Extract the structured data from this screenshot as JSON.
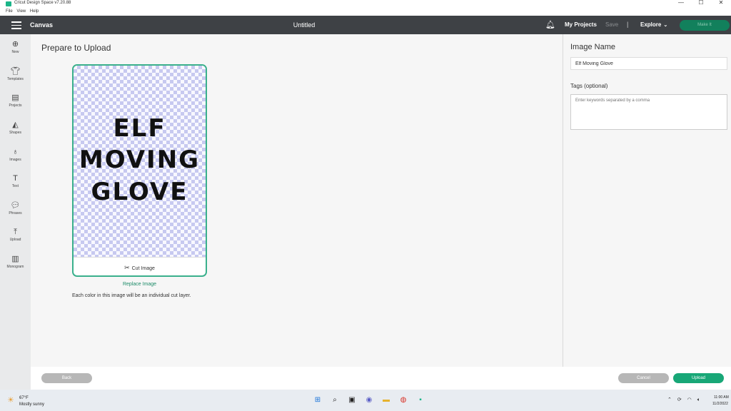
{
  "titlebar": {
    "title": "Cricut Design Space  v7.20.88",
    "minimize": "—",
    "maximize": "☐",
    "close": "✕"
  },
  "menu": {
    "items": [
      "File",
      "View",
      "Help"
    ]
  },
  "header": {
    "canvas_label": "Canvas",
    "doc_title": "Untitled",
    "my_projects": "My Projects",
    "save": "Save",
    "separator": "|",
    "explore": "Explore",
    "make_it": "Make It"
  },
  "leftnav": {
    "items": [
      {
        "label": "New",
        "icon": "plus-circle-icon"
      },
      {
        "label": "Templates",
        "icon": "shirt-icon"
      },
      {
        "label": "Projects",
        "icon": "clipboard-icon"
      },
      {
        "label": "Shapes",
        "icon": "shapes-icon"
      },
      {
        "label": "Images",
        "icon": "lightbulb-icon"
      },
      {
        "label": "Text",
        "icon": "text-icon"
      },
      {
        "label": "Phrases",
        "icon": "speech-bubble-icon"
      },
      {
        "label": "Upload",
        "icon": "upload-icon"
      },
      {
        "label": "Monogram",
        "icon": "monogram-icon"
      }
    ]
  },
  "main": {
    "title": "Prepare to Upload",
    "artwork_lines": [
      "ELF",
      "MOVING",
      "GLOVE"
    ],
    "cut_image_label": "Cut Image",
    "replace_image": "Replace Image",
    "hint": "Each color in this image will be an individual cut layer."
  },
  "rightpanel": {
    "image_name_label": "Image Name",
    "image_name_value": "Elf Moving Glove",
    "tags_label": "Tags (optional)",
    "tags_placeholder": "Enter keywords separated by a comma"
  },
  "footer": {
    "back": "Back",
    "cancel": "Cancel",
    "upload": "Upload"
  },
  "taskbar": {
    "temp": "67°F",
    "weather": "Mostly sunny",
    "time": "11:00 AM",
    "date": "11/2/2022"
  },
  "colors": {
    "accent": "#1bb589",
    "header_bg": "#3e4145",
    "upload_btn": "#18a777"
  }
}
